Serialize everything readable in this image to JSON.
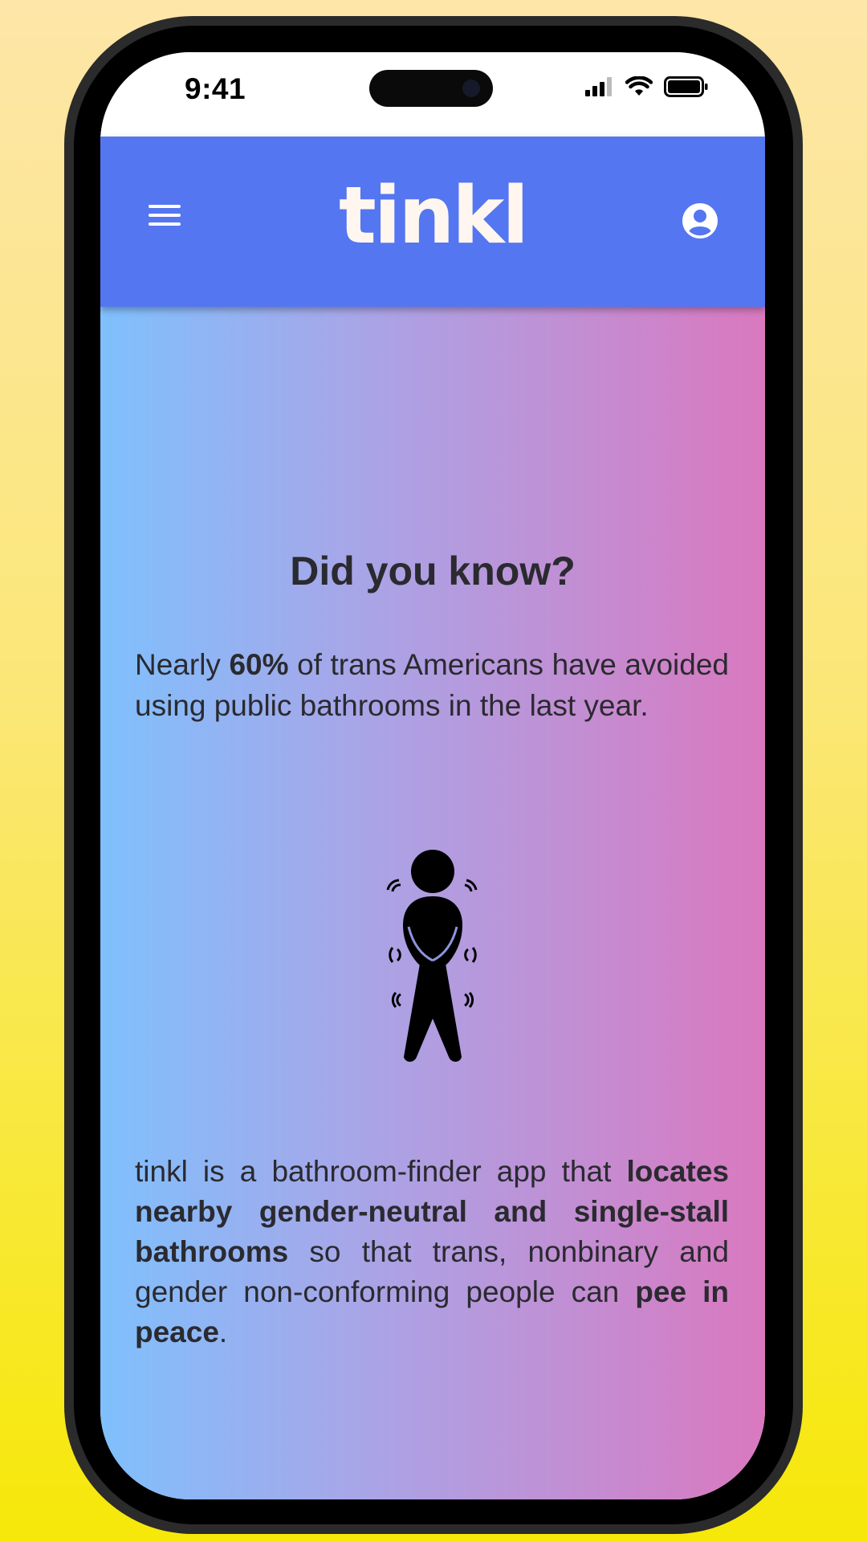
{
  "status_bar": {
    "time": "9:41"
  },
  "app": {
    "logo": "tinkl",
    "brand_color": "#5576f1",
    "menu_icon": "hamburger-menu-icon",
    "profile_icon": "user-circle-icon"
  },
  "content": {
    "headline": "Did you know?",
    "fact": {
      "before": "Nearly ",
      "highlight": "60%",
      "after": " of trans Americans have avoided using public bathrooms in the last year."
    },
    "illustration_icon": "person-needs-to-pee-icon",
    "about": {
      "part1": "tinkl is a bathroom-finder app that ",
      "bold1": "locates nearby gender-neutral and single-stall bathrooms",
      "part2": " so that trans, nonbinary and gender non-conforming people can ",
      "bold2": "pee in peace",
      "part3": "."
    }
  }
}
